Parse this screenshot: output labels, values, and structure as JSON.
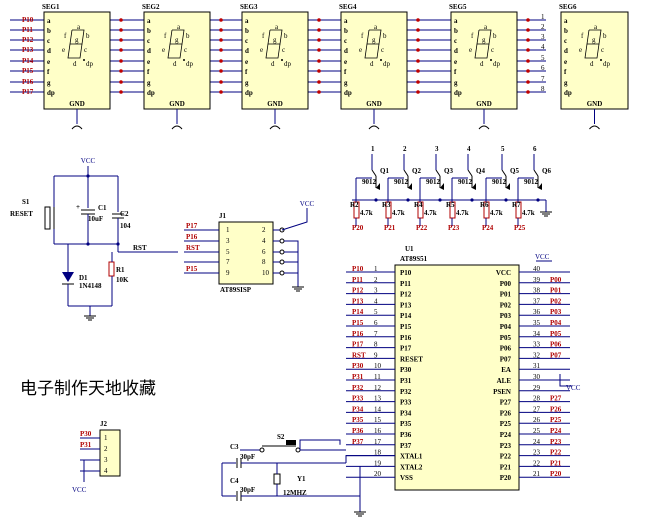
{
  "watermark": "电子制作天地收藏",
  "segments": {
    "names": [
      "SEG1",
      "SEG2",
      "SEG3",
      "SEG4",
      "SEG5",
      "SEG6"
    ],
    "row_labels": [
      "P10",
      "P11",
      "P12",
      "P13",
      "P14",
      "P15",
      "P16",
      "P17"
    ],
    "pin_letters": [
      "a",
      "b",
      "c",
      "d",
      "e",
      "f",
      "g",
      "dp"
    ],
    "digit_numbers": [
      "1",
      "2",
      "3",
      "4",
      "5",
      "6",
      "7",
      "8"
    ],
    "gnd": "GND"
  },
  "transistors": {
    "names": [
      "Q1",
      "Q2",
      "Q3",
      "Q4",
      "Q5",
      "Q6"
    ],
    "type": "9012",
    "top_numbers": [
      "1",
      "2",
      "3",
      "4",
      "5",
      "6"
    ],
    "resistors": [
      "R2",
      "R3",
      "R4",
      "R5",
      "R6",
      "R7"
    ],
    "value": "4.7k",
    "bottom_labels": [
      "P20",
      "P21",
      "P22",
      "P23",
      "P24",
      "P25"
    ]
  },
  "reset": {
    "vcc": "VCC",
    "s1": "S1",
    "reset": "RESET",
    "c1": "C1",
    "c1_value": "10uF",
    "c2": "C2",
    "c2_value": "104",
    "r1": "R1",
    "r1_value": "10K",
    "d1": "D1",
    "d1_value": "1N4148",
    "rst": "RST"
  },
  "isp": {
    "j1": "J1",
    "vcc": "VCC",
    "name": "AT89SISP",
    "left_labels": [
      "P17",
      "P16",
      "RST",
      "",
      "P15"
    ],
    "left_pins": [
      "1",
      "3",
      "5",
      "7",
      "9"
    ],
    "right_pins": [
      "2",
      "4",
      "6",
      "8",
      "10"
    ]
  },
  "mcu": {
    "u1": "U1",
    "name": "AT89S51",
    "vcc": "VCC",
    "left_nets": [
      "P10",
      "P11",
      "P12",
      "P13",
      "P14",
      "P15",
      "P16",
      "P17",
      "RST",
      "P30",
      "P31",
      "P32",
      "P33",
      "P34",
      "P35",
      "P36",
      "P37",
      "",
      "",
      ""
    ],
    "left_pins": [
      "1",
      "2",
      "3",
      "4",
      "5",
      "6",
      "7",
      "8",
      "9",
      "10",
      "11",
      "12",
      "13",
      "14",
      "15",
      "16",
      "17",
      "18",
      "19",
      "20"
    ],
    "left_labels": [
      "P10",
      "P11",
      "P12",
      "P13",
      "P14",
      "P15",
      "P16",
      "P17",
      "RESET",
      "P30",
      "P31",
      "P32",
      "P33",
      "P34",
      "P35",
      "P36",
      "P37",
      "XTAL1",
      "XTAL2",
      "VSS"
    ],
    "right_labels": [
      "VCC",
      "P00",
      "P01",
      "P02",
      "P03",
      "P04",
      "P05",
      "P06",
      "P07",
      "EA",
      "ALE",
      "PSEN",
      "P27",
      "P26",
      "P25",
      "P24",
      "P23",
      "P22",
      "P21",
      "P20"
    ],
    "right_pins": [
      "40",
      "39",
      "38",
      "37",
      "36",
      "35",
      "34",
      "33",
      "32",
      "31",
      "30",
      "29",
      "28",
      "27",
      "26",
      "25",
      "24",
      "23",
      "22",
      "21"
    ],
    "right_nets": [
      "",
      "P00",
      "P01",
      "P02",
      "P03",
      "P04",
      "P05",
      "P06",
      "P07",
      "",
      "",
      "",
      "P27",
      "P26",
      "P25",
      "P24",
      "P23",
      "P22",
      "P21",
      "P20"
    ]
  },
  "crystal": {
    "c3": "C3",
    "c4": "C4",
    "cap_value": "30pF",
    "y1": "Y1",
    "freq": "12MHZ",
    "s2": "S2"
  },
  "j2": {
    "name": "J2",
    "labels": [
      "P30",
      "P31",
      "",
      ""
    ],
    "pins": [
      "1",
      "2",
      "3",
      "4"
    ],
    "vcc": "VCC"
  }
}
